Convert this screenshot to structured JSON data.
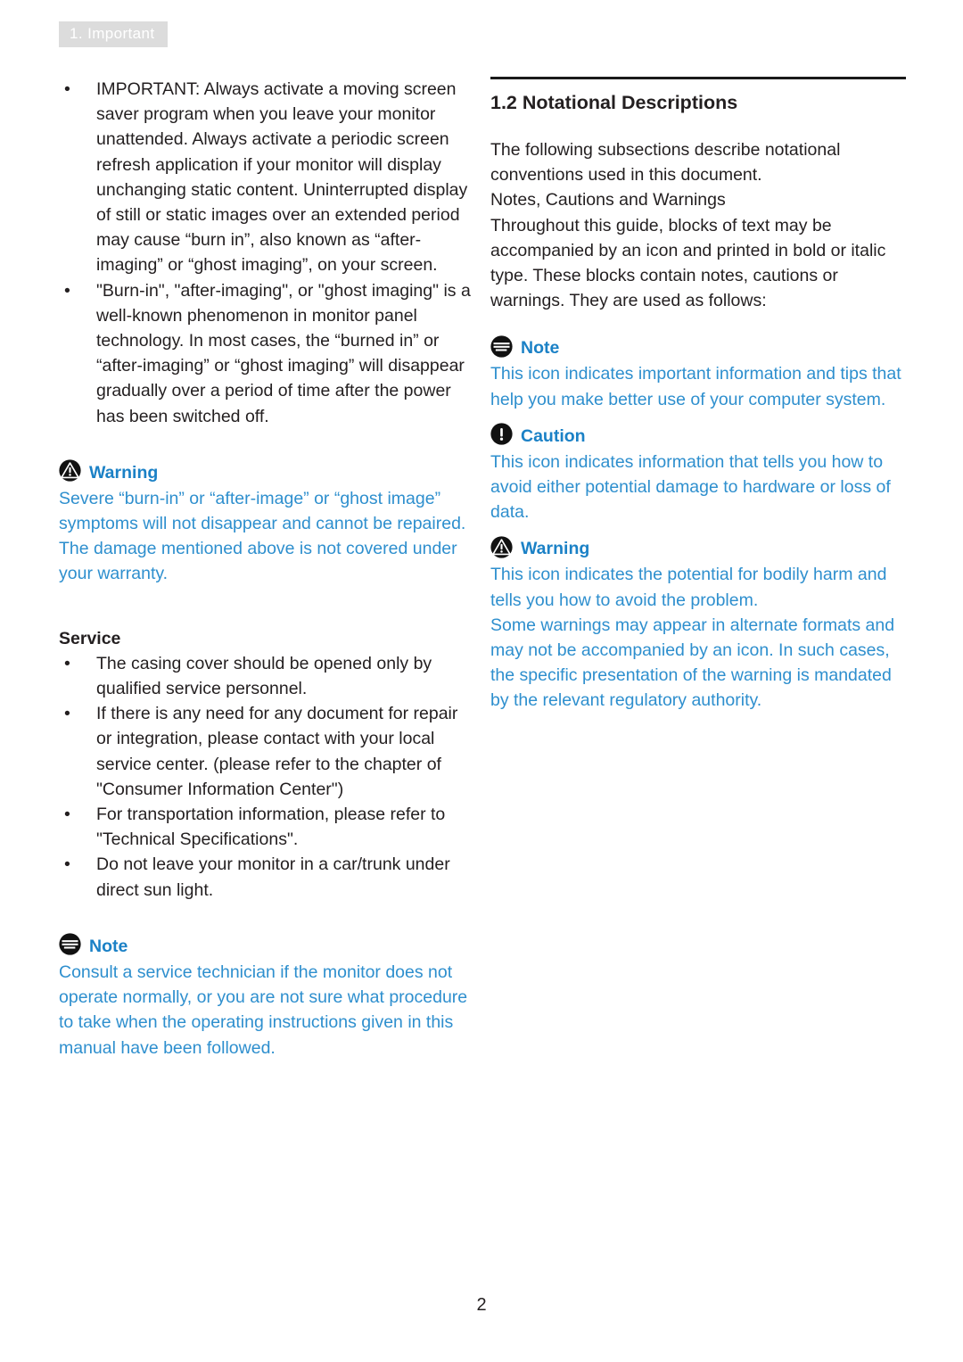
{
  "running_head": {
    "label": "1. Important",
    "background": "#dcdcdc",
    "text_color": "#ffffff"
  },
  "colors": {
    "body_text": "#231f20",
    "callout_title": "#1b81c6",
    "callout_body": "#2e8fce",
    "rule": "#1a1a1a"
  },
  "left_column": {
    "bullets": [
      "IMPORTANT: Always activate a moving screen saver program when you leave your monitor unattended. Always activate a periodic screen refresh application if your monitor will display unchanging static content. Uninterrupted display of still or static images over an extended period may cause “burn in”, also known as “after-imaging” or “ghost imaging”, on your screen.",
      "\"Burn-in\", \"after-imaging\", or \"ghost imaging\" is a well-known phenomenon in monitor panel technology. In most cases, the “burned in” or “after-imaging” or “ghost imaging” will disappear gradually over a period of time after the power has been switched off."
    ],
    "warning_callout": {
      "icon": "warning-triangle-icon",
      "title": "Warning",
      "body": "Severe “burn-in” or “after-image” or “ghost image” symptoms will not disappear and cannot be repaired. The damage mentioned above is not covered under your warranty."
    },
    "service_heading": "Service",
    "service_bullets": [
      "The casing cover should be opened only by qualified service personnel.",
      "If there is any need for any document for repair or integration, please contact with your local service center. (please refer to the chapter of \"Consumer Information Center\")",
      "For transportation information, please refer to \"Technical Specifications\".",
      "Do not leave your monitor in a car/trunk under direct sun light."
    ],
    "note_callout": {
      "icon": "note-lines-icon",
      "title": "Note",
      "body": "Consult a service technician if the monitor does not operate normally, or you are not sure what procedure to take when the operating instructions given in this manual have been followed."
    }
  },
  "right_column": {
    "section_title": "1.2 Notational Descriptions",
    "intro_paragraphs": [
      "The following subsections describe notational conventions used in this document.",
      "Notes, Cautions and Warnings",
      "Throughout this guide, blocks of text may be accompanied by an icon and printed in bold or italic type. These blocks contain notes, cautions or warnings. They are used as follows:"
    ],
    "note_callout": {
      "icon": "note-lines-icon",
      "title": "Note",
      "body": "This icon indicates important information and tips that help you make better use of your computer system."
    },
    "caution_callout": {
      "icon": "caution-exclamation-icon",
      "title": "Caution",
      "body": "This icon indicates information that tells you how to avoid either potential damage to hardware or loss of data."
    },
    "warning_callout": {
      "icon": "warning-triangle-icon",
      "title": "Warning",
      "body_paragraphs": [
        "This icon indicates the potential for bodily harm and tells you how to avoid the problem.",
        "Some warnings may appear in alternate formats and may not be accompanied by an icon. In such cases, the specific presentation of the warning is mandated by the relevant regulatory authority."
      ]
    }
  },
  "footer": {
    "page_number": "2"
  },
  "bullet_glyph": "•"
}
